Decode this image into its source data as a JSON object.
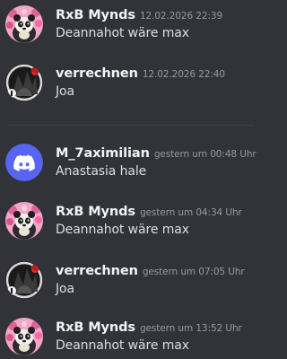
{
  "colors": {
    "background": "#313338",
    "username": "#f2f3f5",
    "timestamp": "#949ba4",
    "message_text": "#dbdee1",
    "discord_blurple": "#5865f2",
    "divider": "#3f4147"
  },
  "messages": [
    {
      "username": "RxB Mynds",
      "timestamp": "12.02.2026 22:39",
      "text": "Deannahot wäre max",
      "avatar_icon": "panda-avatar-icon"
    },
    {
      "username": "verrechnen",
      "timestamp": "12.02.2026 22:40",
      "text": "Joa",
      "avatar_icon": "dark-character-avatar-icon"
    },
    {
      "username": "M_7aximilian",
      "timestamp": "gestern um 00:48 Uhr",
      "text": "Anastasia hale",
      "avatar_icon": "discord-logo-avatar-icon"
    },
    {
      "username": "RxB Mynds",
      "timestamp": "gestern um 04:34 Uhr",
      "text": "Deannahot wäre max",
      "avatar_icon": "panda-avatar-icon"
    },
    {
      "username": "verrechnen",
      "timestamp": "gestern um 07:05 Uhr",
      "text": "Joa",
      "avatar_icon": "dark-character-avatar-icon"
    },
    {
      "username": "RxB Mynds",
      "timestamp": "gestern um 13:52 Uhr",
      "text": "Deannahot wäre max",
      "avatar_icon": "panda-avatar-icon"
    }
  ]
}
